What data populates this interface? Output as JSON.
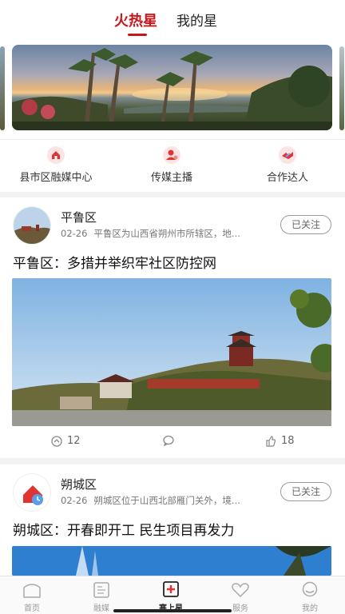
{
  "header": {
    "tabs": [
      {
        "label": "火热星",
        "active": true
      },
      {
        "label": "我的星",
        "active": false
      }
    ],
    "accent_color": "#c8161d"
  },
  "shortcuts": [
    {
      "label": "县市区融媒中心",
      "icon": "media-center-icon"
    },
    {
      "label": "传媒主播",
      "icon": "anchor-person-icon"
    },
    {
      "label": "合作达人",
      "icon": "partner-handshake-icon"
    }
  ],
  "feed": [
    {
      "source": "平鲁区",
      "date": "02-26",
      "summary": "平鲁区为山西省朔州市所辖区，地...",
      "follow_label": "已关注",
      "headline": "平鲁区：多措并举织牢社区防控网",
      "shares": "12",
      "likes": "18"
    },
    {
      "source": "朔城区",
      "date": "02-26",
      "summary": "朔城区位于山西北部雁门关外，境...",
      "follow_label": "已关注",
      "headline": "朔城区：开春即开工 民生项目再发力"
    }
  ],
  "bottom_nav": [
    {
      "label": "首页",
      "icon": "home-icon",
      "active": false
    },
    {
      "label": "融媒",
      "icon": "media-icon",
      "active": false
    },
    {
      "label": "塞上星",
      "icon": "star-app-icon",
      "active": true
    },
    {
      "label": "服务",
      "icon": "heart-icon",
      "active": false
    },
    {
      "label": "我的",
      "icon": "profile-icon",
      "active": false
    }
  ]
}
